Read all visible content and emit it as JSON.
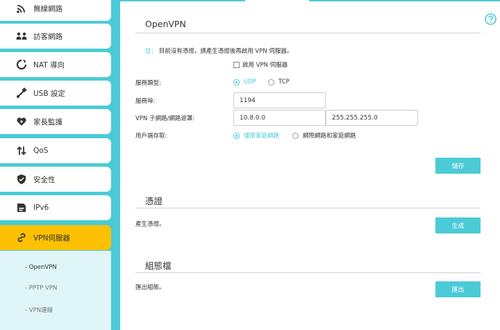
{
  "sidebar": {
    "items": [
      {
        "label": "無線網路",
        "icon": "wifi-icon"
      },
      {
        "label": "訪客網路",
        "icon": "guest-network-icon"
      },
      {
        "label": "NAT 導向",
        "icon": "nat-forwarding-icon"
      },
      {
        "label": "USB 設定",
        "icon": "usb-icon"
      },
      {
        "label": "家長監護",
        "icon": "parental-controls-icon"
      },
      {
        "label": "QoS",
        "icon": "qos-arrows-icon"
      },
      {
        "label": "安全性",
        "icon": "shield-icon"
      },
      {
        "label": "IPv6",
        "icon": "ipv6-icon"
      },
      {
        "label": "VPN伺服器",
        "icon": "vpn-link-icon"
      }
    ],
    "submenu": [
      {
        "label": "- OpenVPN"
      },
      {
        "label": "- PPTP VPN"
      },
      {
        "label": "- VPN連線"
      }
    ]
  },
  "openvpn": {
    "title": "OpenVPN",
    "note_key": "註：",
    "note_text": "目前沒有憑證，請產生憑證後再啟用 VPN 伺服器。",
    "enable_label": "啟用 VPN 伺服器",
    "service_type_label": "服務類型:",
    "udp_label": "UDP",
    "tcp_label": "TCP",
    "port_label": "服務埠:",
    "port_value": "1194",
    "subnet_label": "VPN 子網路/網路遮罩:",
    "subnet_value": "10.8.0.0",
    "netmask_value": "255.255.255.0",
    "access_label": "用戶端存取:",
    "home_only_label": "僅限家庭網路",
    "internet_home_label": "網際網路和家庭網路",
    "save_label": "儲存"
  },
  "certificate": {
    "title": "憑證",
    "generate_text": "產生憑證。",
    "generate_label": "生成"
  },
  "config_file": {
    "title": "組態檔",
    "export_text": "匯出組態。",
    "export_label": "匯出"
  },
  "colors": {
    "accent": "#4acbd6",
    "active": "#fdc002"
  }
}
